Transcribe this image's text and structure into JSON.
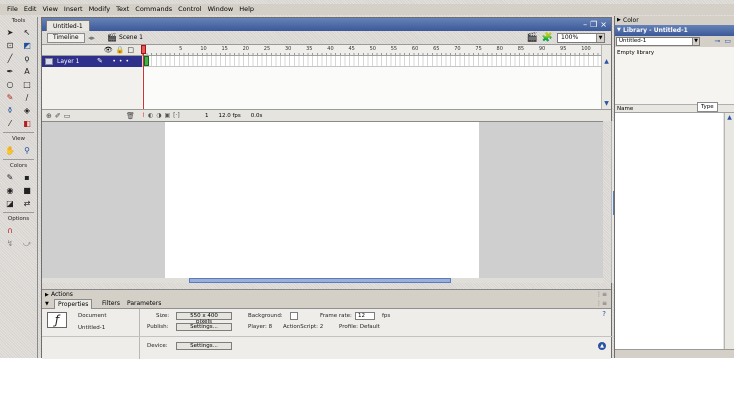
{
  "menu": [
    "File",
    "Edit",
    "View",
    "Insert",
    "Modify",
    "Text",
    "Commands",
    "Control",
    "Window",
    "Help"
  ],
  "tools": {
    "heading": "Tools",
    "view_heading": "View",
    "colors_heading": "Colors",
    "options_heading": "Options"
  },
  "document": {
    "tab_title": "Untitled-1",
    "timeline_button": "Timeline",
    "scene_label": "Scene 1",
    "zoom_value": "100%"
  },
  "timeline": {
    "ruler_labels": [
      "1",
      "5",
      "10",
      "15",
      "20",
      "25",
      "30",
      "35",
      "40",
      "45",
      "50",
      "55",
      "60",
      "65",
      "70",
      "75",
      "80",
      "85",
      "90",
      "95",
      "100",
      "10"
    ],
    "layer_name": "Layer 1",
    "current_frame": "1",
    "frame_rate": "12.0 fps",
    "elapsed": "0.0s"
  },
  "panels": {
    "actions_label": "Actions",
    "tabs": [
      "Properties",
      "Filters",
      "Parameters"
    ]
  },
  "properties": {
    "doc_label": "Document",
    "doc_name": "Untitled-1",
    "size_label": "Size:",
    "size_value": "550 x 400 pixels",
    "background_label": "Background:",
    "frame_rate_label": "Frame rate:",
    "frame_rate_value": "12",
    "fps_label": "fps",
    "publish_label": "Publish:",
    "settings_label": "Settings...",
    "player_label": "Player: 8",
    "actionscript_label": "ActionScript: 2",
    "profile_label": "Profile: Default",
    "device_label": "Device:",
    "device_settings_label": "Settings..."
  },
  "right_panel": {
    "color_header": "Color",
    "library_header": "Library - Untitled-1",
    "library_doc": "Untitled-1",
    "empty_library": "Empty library",
    "col_name": "Name",
    "col_type": "Type"
  }
}
